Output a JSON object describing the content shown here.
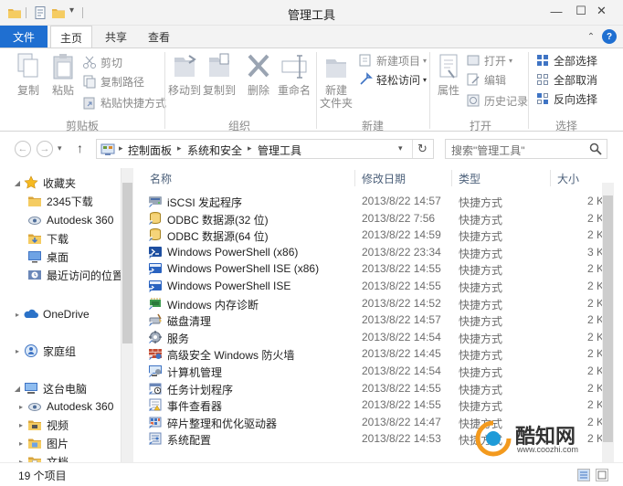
{
  "window": {
    "title": "管理工具",
    "controls": [
      "minimize",
      "maximize",
      "close"
    ],
    "minimize_glyph": "—",
    "maximize_glyph": "☐",
    "close_glyph": "✕"
  },
  "quick_access": {
    "dropdown_glyph": "▾"
  },
  "ribbon_tabs": {
    "file": "文件",
    "home": "主页",
    "share": "共享",
    "view": "查看",
    "collapse_glyph": "⌃",
    "help_glyph": "?"
  },
  "ribbon": {
    "clipboard": {
      "label": "剪贴板",
      "copy": "复制",
      "paste": "粘贴",
      "cut": "剪切",
      "copy_path": "复制路径",
      "paste_shortcut": "粘贴快捷方式"
    },
    "organize": {
      "label": "组织",
      "move_to": "移动到",
      "copy_to": "复制到",
      "delete": "删除",
      "rename": "重命名"
    },
    "new": {
      "label": "新建",
      "new_folder_line1": "新建",
      "new_folder_line2": "文件夹",
      "new_item": "新建项目",
      "easy_access": "轻松访问"
    },
    "open": {
      "label": "打开",
      "properties": "属性",
      "open": "打开",
      "edit": "编辑",
      "history": "历史记录"
    },
    "select": {
      "label": "选择",
      "select_all": "全部选择",
      "select_none": "全部取消",
      "invert": "反向选择"
    }
  },
  "address": {
    "back_glyph": "←",
    "forward_glyph": "→",
    "recent_glyph": "▾",
    "up_glyph": "↑",
    "breadcrumbs": [
      "控制面板",
      "系统和安全",
      "管理工具"
    ],
    "sep_glyph": "▸",
    "dropdown_glyph": "▾",
    "refresh_glyph": "↻",
    "search_placeholder": "搜索\"管理工具\"",
    "search_glyph": "⚲"
  },
  "nav_pane": {
    "expand_glyph": "▸",
    "collapse_glyph": "◢",
    "items": [
      {
        "label": "收藏夹",
        "icon": "star-icon",
        "level": 0,
        "expanded": true
      },
      {
        "label": "2345下载",
        "icon": "folder-icon",
        "level": 1
      },
      {
        "label": "Autodesk 360",
        "icon": "cloud-eye-icon",
        "level": 1
      },
      {
        "label": "下载",
        "icon": "download-folder-icon",
        "level": 1
      },
      {
        "label": "桌面",
        "icon": "desktop-icon",
        "level": 1
      },
      {
        "label": "最近访问的位置",
        "icon": "recent-places-icon",
        "level": 1
      },
      {
        "label": "OneDrive",
        "icon": "onedrive-icon",
        "level": 0,
        "expanded": false
      },
      {
        "label": "家庭组",
        "icon": "homegroup-icon",
        "level": 0,
        "expanded": false
      },
      {
        "label": "这台电脑",
        "icon": "computer-icon",
        "level": 0,
        "expanded": true
      },
      {
        "label": "Autodesk 360",
        "icon": "cloud-eye-icon",
        "level": 1,
        "expanded": false
      },
      {
        "label": "视频",
        "icon": "videos-folder-icon",
        "level": 1,
        "expanded": false
      },
      {
        "label": "图片",
        "icon": "pictures-folder-icon",
        "level": 1,
        "expanded": false
      },
      {
        "label": "文档",
        "icon": "documents-folder-icon",
        "level": 1,
        "expanded": false
      }
    ]
  },
  "columns": {
    "name": "名称",
    "modified": "修改日期",
    "type": "类型",
    "size": "大小",
    "sort_glyph": "^"
  },
  "files": [
    {
      "name": "iSCSI 发起程序",
      "modified": "2013/8/22 14:57",
      "type": "快捷方式",
      "size": "2 K",
      "icon": "iscsi-icon"
    },
    {
      "name": "ODBC 数据源(32 位)",
      "modified": "2013/8/22 7:56",
      "type": "快捷方式",
      "size": "2 K",
      "icon": "odbc-icon"
    },
    {
      "name": "ODBC 数据源(64 位)",
      "modified": "2013/8/22 14:59",
      "type": "快捷方式",
      "size": "2 K",
      "icon": "odbc-icon"
    },
    {
      "name": "Windows PowerShell (x86)",
      "modified": "2013/8/22 23:34",
      "type": "快捷方式",
      "size": "3 K",
      "icon": "powershell-icon"
    },
    {
      "name": "Windows PowerShell ISE (x86)",
      "modified": "2013/8/22 14:55",
      "type": "快捷方式",
      "size": "2 K",
      "icon": "powershell-ise-icon"
    },
    {
      "name": "Windows PowerShell ISE",
      "modified": "2013/8/22 14:55",
      "type": "快捷方式",
      "size": "2 K",
      "icon": "powershell-ise-icon"
    },
    {
      "name": "Windows 内存诊断",
      "modified": "2013/8/22 14:52",
      "type": "快捷方式",
      "size": "2 K",
      "icon": "memory-diagnostic-icon"
    },
    {
      "name": "磁盘清理",
      "modified": "2013/8/22 14:57",
      "type": "快捷方式",
      "size": "2 K",
      "icon": "disk-cleanup-icon"
    },
    {
      "name": "服务",
      "modified": "2013/8/22 14:54",
      "type": "快捷方式",
      "size": "2 K",
      "icon": "services-icon"
    },
    {
      "name": "高级安全 Windows 防火墙",
      "modified": "2013/8/22 14:45",
      "type": "快捷方式",
      "size": "2 K",
      "icon": "firewall-icon"
    },
    {
      "name": "计算机管理",
      "modified": "2013/8/22 14:54",
      "type": "快捷方式",
      "size": "2 K",
      "icon": "computer-management-icon"
    },
    {
      "name": "任务计划程序",
      "modified": "2013/8/22 14:55",
      "type": "快捷方式",
      "size": "2 K",
      "icon": "task-scheduler-icon"
    },
    {
      "name": "事件查看器",
      "modified": "2013/8/22 14:55",
      "type": "快捷方式",
      "size": "2 K",
      "icon": "event-viewer-icon"
    },
    {
      "name": "碎片整理和优化驱动器",
      "modified": "2013/8/22 14:47",
      "type": "快捷方式",
      "size": "2 K",
      "icon": "defrag-icon"
    },
    {
      "name": "系统配置",
      "modified": "2013/8/22 14:53",
      "type": "快捷方式",
      "size": "2 K",
      "icon": "system-config-icon"
    }
  ],
  "status": {
    "count": "19 个项目"
  },
  "watermark": {
    "brand": "酷知网",
    "url": "www.coozhi.com"
  },
  "colors": {
    "accent": "#1f6fd1",
    "title_bg": "#f3f3f3",
    "folder": "#e8b54a",
    "column_header": "#4c607a"
  }
}
